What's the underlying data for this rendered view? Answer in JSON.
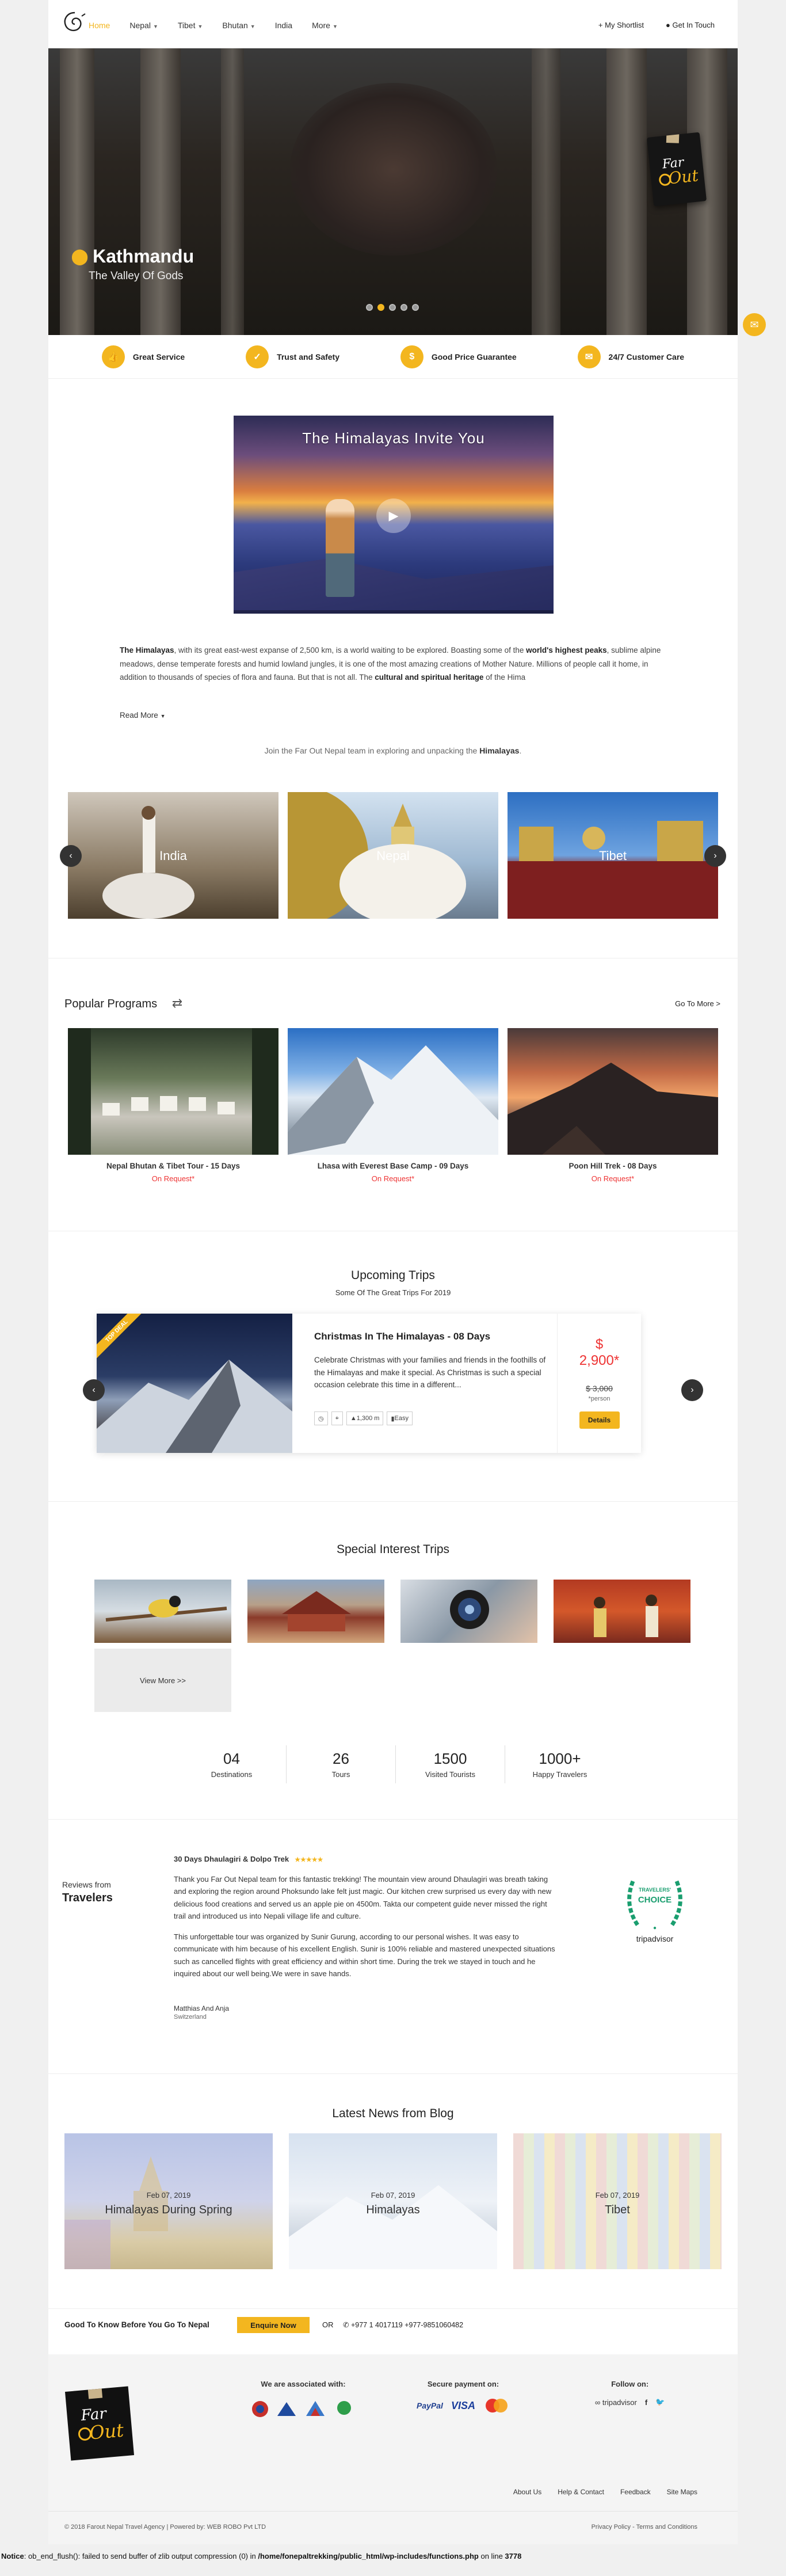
{
  "nav": {
    "items": [
      {
        "label": "Home",
        "active": true
      },
      {
        "label": "Nepal",
        "dropdown": true
      },
      {
        "label": "Tibet",
        "dropdown": true
      },
      {
        "label": "Bhutan",
        "dropdown": true
      },
      {
        "label": "India"
      },
      {
        "label": "More",
        "dropdown": true
      }
    ],
    "shortlist": "My Shortlist",
    "get_in_touch": "Get In Touch"
  },
  "hero": {
    "title": "Kathmandu",
    "subtitle": "The Valley Of Gods",
    "slide_count": 5,
    "active_slide": 2
  },
  "features": [
    {
      "label": "Great Service",
      "icon": "thumb-icon"
    },
    {
      "label": "Trust and Safety",
      "icon": "shield-icon"
    },
    {
      "label": "Good Price Guarantee",
      "icon": "tag-icon"
    },
    {
      "label": "24/7 Customer Care",
      "icon": "chat-icon"
    }
  ],
  "video": {
    "title": "The Himalayas Invite You"
  },
  "intro": {
    "p1_a": "The Himalayas",
    "p1_b": ", with its great east-west expanse of 2,500 km, is a world waiting to be explored. Boasting some of the ",
    "p1_c": "world's highest peaks",
    "p1_d": ", sublime alpine meadows, dense temperate forests and humid lowland jungles, it is one of the most amazing creations of Mother Nature. Millions of people call it home, in addition to thousands of species of flora and fauna. But that is not all. The ",
    "p1_e": "cultural and spiritual heritage",
    "p1_f": " of the Hima",
    "read_more": "Read More",
    "join_a": "Join the Far Out Nepal team in exploring and unpacking the ",
    "join_b": "Himalayas",
    "join_c": "."
  },
  "destinations": [
    "India",
    "Nepal",
    "Tibet"
  ],
  "popular": {
    "title": "Popular Programs",
    "goto": "Go To More >",
    "items": [
      {
        "name": "Nepal Bhutan & Tibet Tour - 15 Days",
        "price": "On Request*"
      },
      {
        "name": "Lhasa with Everest Base Camp - 09 Days",
        "price": "On Request*"
      },
      {
        "name": "Poon Hill Trek - 08 Days",
        "price": "On Request*"
      }
    ]
  },
  "upcoming": {
    "title": "Upcoming Trips",
    "subtitle": "Some Of The Great Trips For 2019",
    "ribbon": "TOP DEAL",
    "trip_title": "Christmas In The Himalayas - 08 Days",
    "trip_desc": "Celebrate Christmas with your families and friends in the foothills of the Himalayas and make it special. As Christmas is such a special occasion celebrate this time in a different...",
    "altitude": "1,300 m",
    "difficulty": "Easy",
    "currency": "$",
    "price": "2,900*",
    "old_price": "$ 3,000",
    "per": "*person",
    "details": "Details"
  },
  "special": {
    "title": "Special Interest Trips",
    "view_more": "View More >>"
  },
  "stats": [
    {
      "value": "04",
      "label": "Destinations"
    },
    {
      "value": "26",
      "label": "Tours"
    },
    {
      "value": "1500",
      "label": "Visited Tourists"
    },
    {
      "value": "1000+",
      "label": "Happy Travelers"
    }
  ],
  "reviews": {
    "label_top": "Reviews from",
    "label_bottom": "Travelers",
    "title": "30 Days Dhaulagiri & Dolpo Trek",
    "stars": "★★★★★",
    "p1": "Thank you Far Out Nepal team for this fantastic trekking! The mountain view around Dhaulagiri was breath taking and exploring the region around Phoksundo lake felt just magic. Our kitchen crew surprised us every day with new delicious food creations and served us an apple pie on 4500m. Takta our competent guide never missed the right trail and introduced us into Nepali village life and culture.",
    "p2": "This unforgettable tour was organized by Sunir Gurung, according to our personal wishes. It was easy to communicate with him because of his excellent English. Sunir is 100% reliable and mastered unexpected situations such as cancelled flights with great efficiency and within short time. During the trek we stayed in touch and he inquired about our well being.We were in save hands.",
    "name": "Matthias And Anja",
    "location": "Switzerland",
    "ta_top": "TRAVELERS'",
    "ta_mid": "CHOICE",
    "ta_bottom": "tripadvisor"
  },
  "blog": {
    "title": "Latest News from Blog",
    "items": [
      {
        "date": "Feb 07, 2019",
        "title": "Himalayas During Spring"
      },
      {
        "date": "Feb 07, 2019",
        "title": "Himalayas"
      },
      {
        "date": "Feb 07, 2019",
        "title": "Tibet"
      }
    ]
  },
  "enquire": {
    "text": "Good To Know Before You Go To Nepal",
    "button": "Enquire Now",
    "or": "OR",
    "phone": "+977 1 4017119 +977-9851060482"
  },
  "footer": {
    "associated": "We are associated with:",
    "payment": "Secure payment on:",
    "follow": "Follow on:",
    "paypal": "PayPal",
    "visa": "VISA",
    "tripadvisor": "tripadvisor",
    "links": [
      "About Us",
      "Help & Contact",
      "Feedback",
      "Site Maps"
    ],
    "copyright": "© 2018 Farout Nepal Travel Agency | Powered by: WEB ROBO Pvt LTD",
    "policy": "Privacy Policy - Terms and Conditions"
  },
  "notice": {
    "label": "Notice",
    "text_a": ": ob_end_flush(): failed to send buffer of zlib output compression (0) in ",
    "path": "/home/fonepaltrekking/public_html/wp-includes/functions.php",
    "text_b": " on line ",
    "line": "3778"
  },
  "colors": {
    "accent": "#f3b61f",
    "price": "#e33333"
  }
}
